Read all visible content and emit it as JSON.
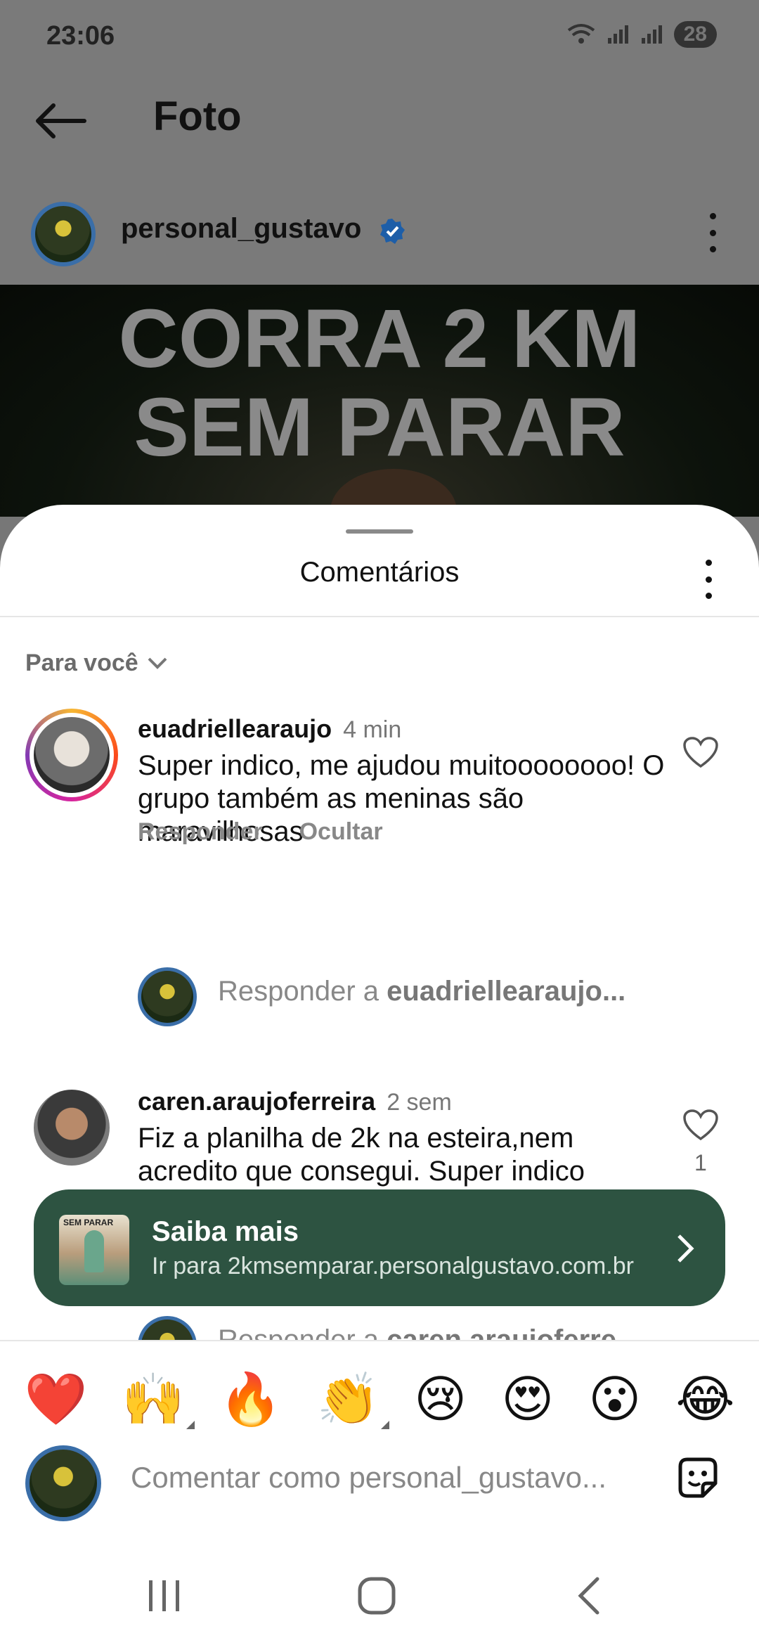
{
  "status_bar": {
    "time": "23:06",
    "battery": "28"
  },
  "header": {
    "title": "Foto"
  },
  "post": {
    "author": "personal_gustavo",
    "headline_line1": "CORRA 2 KM",
    "headline_line2": "SEM PARAR"
  },
  "sheet": {
    "title": "Comentários",
    "filter_label": "Para você"
  },
  "comments": [
    {
      "user": "euadriellearaujo",
      "time": "4 min",
      "text": "Super indico, me ajudou muitoooooooo! O grupo também as meninas são maravilhosas",
      "reply_label": "Responder",
      "hide_label": "Ocultar",
      "reply_prompt_prefix": "Responder a ",
      "reply_prompt_user": "euadriellearaujo..."
    },
    {
      "user": "caren.araujoferreira",
      "time": "2 sem",
      "text": "Fiz a planilha de 2k na esteira,nem acredito que consegui.  Super indico",
      "likes": "1",
      "reply_prompt_prefix": "Responder a ",
      "reply_prompt_user": "caren.araujoferre..."
    }
  ],
  "promo": {
    "thumb_label": "SEM PARAR",
    "title": "Saiba mais",
    "subtitle": "Ir para 2kmsemparar.personalgustavo.com.br"
  },
  "reactions": [
    "❤️",
    "🙌",
    "🔥",
    "👏",
    "😢",
    "😍",
    "😮",
    "😂"
  ],
  "composer": {
    "placeholder": "Comentar como personal_gustavo..."
  }
}
